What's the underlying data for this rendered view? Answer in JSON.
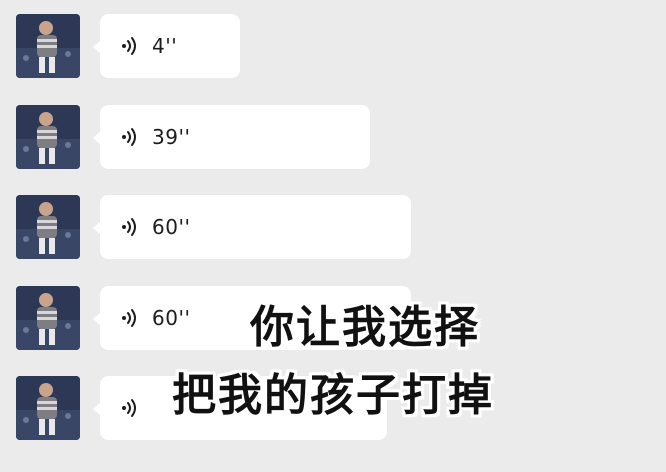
{
  "chat": {
    "messages": [
      {
        "type": "voice",
        "duration": "4''",
        "icon": "voice-message-icon"
      },
      {
        "type": "voice",
        "duration": "39''",
        "icon": "voice-message-icon"
      },
      {
        "type": "voice",
        "duration": "60''",
        "icon": "voice-message-icon"
      },
      {
        "type": "voice",
        "duration": "60''",
        "icon": "voice-message-icon"
      },
      {
        "type": "voice",
        "duration": "",
        "icon": "voice-message-icon"
      }
    ]
  },
  "caption": {
    "line1": "你让我选择",
    "line2": "把我的孩子打掉"
  },
  "colors": {
    "background": "#ebebec",
    "bubble": "#ffffff",
    "text": "#1c1c1c"
  }
}
